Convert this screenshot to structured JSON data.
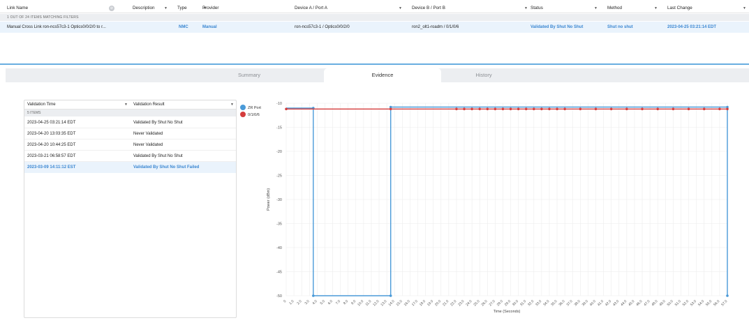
{
  "grid": {
    "columns": [
      {
        "label": "Link Name"
      },
      {
        "label": "Description"
      },
      {
        "label": "Type"
      },
      {
        "label": "Provider"
      },
      {
        "label": "Device A / Port A"
      },
      {
        "label": "Device B / Port B"
      },
      {
        "label": "Status"
      },
      {
        "label": "Method"
      },
      {
        "label": "Last Change"
      }
    ],
    "match_text": "1 OUT OF 24 ITEMS MATCHING FILTERS",
    "row": {
      "link_name": "Manual Cross Link ron-ncs57c3-1 Optics0/0/2/0 to r...",
      "description": "",
      "type": "NMC",
      "provider": "Manual",
      "device_a": "ron-ncs57c3-1 / Optics0/0/2/0",
      "device_b": "ron2_olt1-roadm / 0/1/0/6",
      "status": "Validated By Shut No Shut",
      "method": "Shut no shut",
      "last_change": "2023-04-25 03:21:14 EDT"
    }
  },
  "tabs": [
    {
      "label": "Summary",
      "active": false
    },
    {
      "label": "Evidence",
      "active": true
    },
    {
      "label": "History",
      "active": false
    }
  ],
  "validation": {
    "columns": [
      "Validation Time",
      "Validation Result"
    ],
    "count_text": "5 ITEMS",
    "rows": [
      {
        "time": "2023-04-25 03:21:14 EDT",
        "result": "Validated By Shut No Shut"
      },
      {
        "time": "2023-04-20 13:03:35 EDT",
        "result": "Never Validated"
      },
      {
        "time": "2023-04-20 10:44:25 EDT",
        "result": "Never Validated"
      },
      {
        "time": "2023-03-21 06:58:57 EDT",
        "result": "Validated By Shut No Shut"
      },
      {
        "time": "2023-03-09 14:11:12 EST",
        "result": "Validated By Shut No Shut Failed"
      }
    ]
  },
  "colors": {
    "accent_blue": "#3a86d1",
    "zr_port": "#4a9ad8",
    "port_0106": "#d43c3c",
    "selected_row": "#eaf3fc",
    "header_bar": "#eceef1"
  },
  "chart_data": {
    "type": "line",
    "xlabel": "Time (Seconds)",
    "ylabel": "Power (dBm)",
    "ylim": [
      -50,
      -10
    ],
    "yticks": [
      -10,
      -15,
      -20,
      -25,
      -30,
      -35,
      -40,
      -45,
      -50
    ],
    "xticks": [
      "0",
      "1.0",
      "2.0",
      "3.0",
      "4.0",
      "5.0",
      "6.0",
      "7.0",
      "8.0",
      "9.0",
      "10.0",
      "11.0",
      "12.0",
      "13.0",
      "14.0",
      "15.0",
      "16.0",
      "17.0",
      "18.0",
      "19.0",
      "20.0",
      "21.0",
      "22.0",
      "23.0",
      "24.0",
      "25.0",
      "26.0",
      "27.0",
      "28.0",
      "29.0",
      "30.0",
      "31.0",
      "32.0",
      "33.0",
      "34.0",
      "35.0",
      "36.0",
      "37.0",
      "38.0",
      "39.0",
      "40.0",
      "41.0",
      "42.0",
      "43.0",
      "44.0",
      "45.0",
      "46.0",
      "47.0",
      "48.0",
      "49.0",
      "50.0",
      "51.0",
      "52.0",
      "53.0",
      "54.0",
      "55.0",
      "56.0",
      "57.0"
    ],
    "legend_position": "top-left",
    "grid": true,
    "series": [
      {
        "name": "ZR Port",
        "color": "#4a9ad8",
        "points": [
          [
            0,
            -11
          ],
          [
            3.5,
            -11
          ],
          [
            3.5,
            -50
          ],
          [
            13.5,
            -50
          ],
          [
            13.5,
            -10.8
          ],
          [
            57,
            -10.8
          ],
          [
            57,
            -50
          ]
        ],
        "markers": [
          [
            3.5,
            -11
          ],
          [
            3.5,
            -50
          ],
          [
            13.5,
            -50
          ],
          [
            13.5,
            -10.8
          ],
          [
            57,
            -10.8
          ],
          [
            57,
            -50
          ]
        ]
      },
      {
        "name": "0/1/0/6",
        "color": "#d43c3c",
        "points": [
          [
            0,
            -11.2
          ],
          [
            57,
            -11.2
          ]
        ],
        "markers": [
          [
            0,
            -11.2
          ],
          [
            13.5,
            -11.2
          ],
          [
            22,
            -11.2
          ],
          [
            23,
            -11.2
          ],
          [
            24,
            -11.2
          ],
          [
            25,
            -11.2
          ],
          [
            26,
            -11.2
          ],
          [
            27,
            -11.2
          ],
          [
            28,
            -11.2
          ],
          [
            29,
            -11.2
          ],
          [
            30,
            -11.2
          ],
          [
            31,
            -11.2
          ],
          [
            32,
            -11.2
          ],
          [
            33,
            -11.2
          ],
          [
            34,
            -11.2
          ],
          [
            35,
            -11.2
          ],
          [
            36,
            -11.2
          ],
          [
            38,
            -11.2
          ],
          [
            40,
            -11.2
          ],
          [
            42,
            -11.2
          ],
          [
            44,
            -11.2
          ],
          [
            46,
            -11.2
          ],
          [
            48,
            -11.2
          ],
          [
            50,
            -11.2
          ],
          [
            52,
            -11.2
          ],
          [
            54,
            -11.2
          ],
          [
            56,
            -11.2
          ],
          [
            57,
            -11.2
          ]
        ]
      }
    ]
  }
}
